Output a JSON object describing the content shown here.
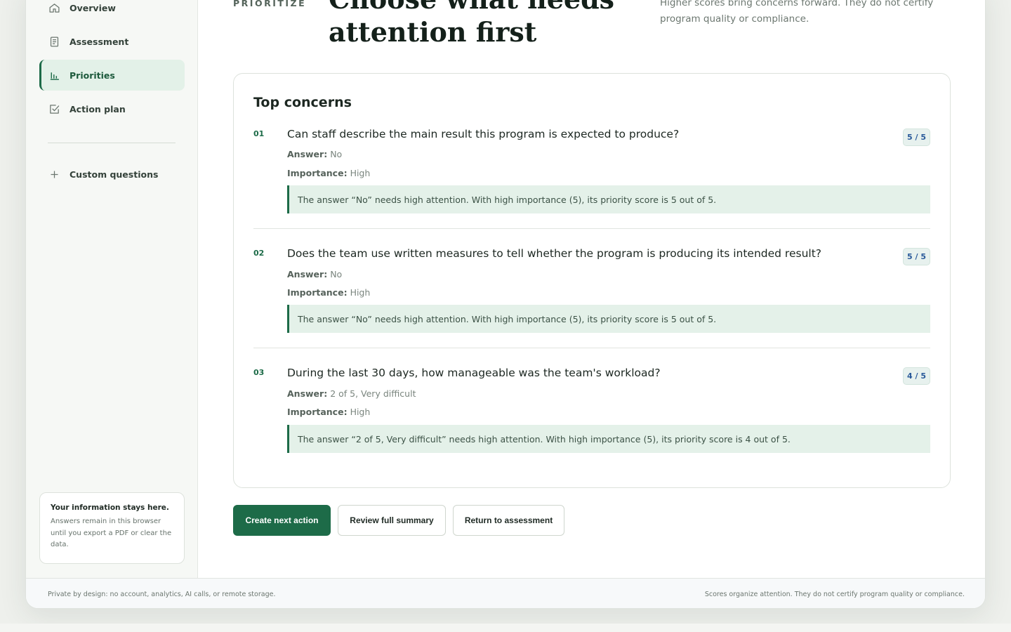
{
  "sidebar": {
    "items": [
      {
        "label": "Overview",
        "icon": "home-icon",
        "active": false
      },
      {
        "label": "Assessment",
        "icon": "document-icon",
        "active": false
      },
      {
        "label": "Priorities",
        "icon": "bar-chart-icon",
        "active": true
      },
      {
        "label": "Action plan",
        "icon": "checkbox-icon",
        "active": false
      }
    ],
    "custom_questions": {
      "label": "Custom questions",
      "icon": "plus-icon"
    },
    "info": {
      "title": "Your information stays here.",
      "body": "Answers remain in this browser until you export a PDF or clear the data."
    }
  },
  "header": {
    "eyebrow": "PRIORITIZE",
    "title": "Choose what needs attention first",
    "note": "Higher scores bring concerns forward. They do not certify program quality or compliance."
  },
  "concerns": {
    "title": "Top concerns",
    "answer_label": "Answer:",
    "importance_label": "Importance:",
    "items": [
      {
        "num": "01",
        "question": "Can staff describe the main result this program is expected to produce?",
        "score": "5 / 5",
        "answer": "No",
        "importance": "High",
        "explanation": "The answer “No” needs high attention. With high importance (5), its priority score is 5 out of 5."
      },
      {
        "num": "02",
        "question": "Does the team use written measures to tell whether the program is producing its intended result?",
        "score": "5 / 5",
        "answer": "No",
        "importance": "High",
        "explanation": "The answer “No” needs high attention. With high importance (5), its priority score is 5 out of 5."
      },
      {
        "num": "03",
        "question": "During the last 30 days, how manageable was the team's workload?",
        "score": "4 / 5",
        "answer": "2 of 5, Very difficult",
        "importance": "High",
        "explanation": "The answer “2 of 5, Very difficult” needs high attention. With high importance (5), its priority score is 4 out of 5."
      }
    ]
  },
  "actions": {
    "primary": "Create next action",
    "review": "Review full summary",
    "return": "Return to assessment"
  },
  "footer": {
    "left": "Private by design: no account, analytics, AI calls, or remote storage.",
    "right": "Scores organize attention. They do not certify program quality or compliance."
  },
  "colors": {
    "accent": "#1d6b48",
    "accent_soft": "#e4f1e9",
    "score_text": "#2a5a9a"
  }
}
